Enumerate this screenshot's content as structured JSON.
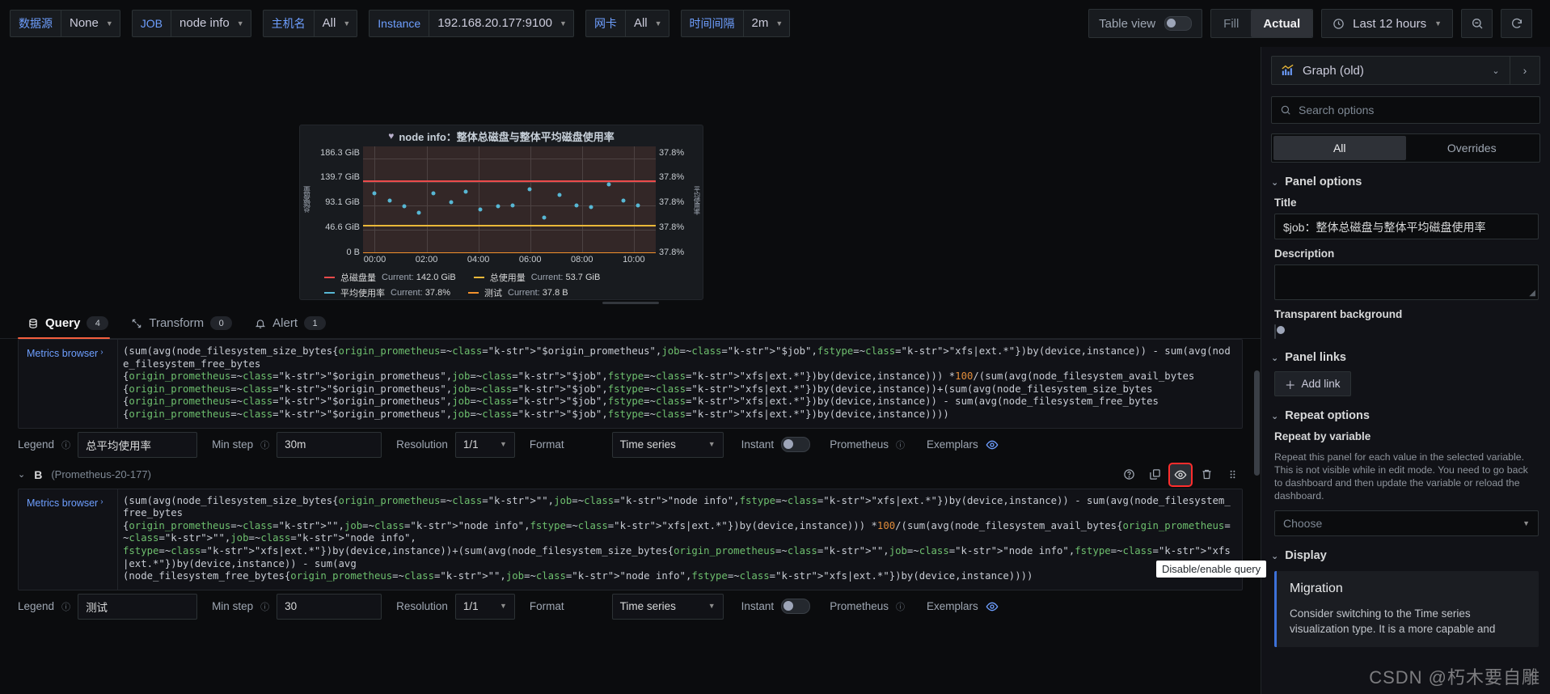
{
  "topbar": {
    "variables": [
      {
        "label": "数据源",
        "value": "None",
        "name": "datasource"
      },
      {
        "label": "JOB",
        "value": "node info",
        "name": "job"
      },
      {
        "label": "主机名",
        "value": "All",
        "name": "hostname"
      },
      {
        "label": "Instance",
        "value": "192.168.20.177:9100",
        "name": "instance"
      },
      {
        "label": "网卡",
        "value": "All",
        "name": "nic"
      },
      {
        "label": "时间间隔",
        "value": "2m",
        "name": "interval"
      }
    ],
    "table_view_label": "Table view",
    "table_view_on": false,
    "fill_label": "Fill",
    "actual_label": "Actual",
    "fill_actual_selected": "Actual",
    "time_range": "Last 12 hours",
    "zoom_out_icon": "zoom-out-icon",
    "refresh_icon": "refresh-icon",
    "clock_icon": "clock-icon"
  },
  "panel": {
    "title_prefix": "node info：",
    "title": "node info：整体总磁盘与整体平均磁盘使用率",
    "heart_icon": "heart-icon"
  },
  "chart_data": {
    "type": "scatter",
    "title": "node info：整体总磁盘与整体平均磁盘使用率",
    "xlabel": "",
    "ylabel": "总磁盘量",
    "ylabel_right": "平均使用率",
    "grid": true,
    "legend_position": "bottom",
    "y_ticks": [
      "186.3 GiB",
      "139.7 GiB",
      "93.1 GiB",
      "46.6 GiB",
      "0 B"
    ],
    "y_values": [
      186.3,
      139.7,
      93.1,
      46.6,
      0
    ],
    "y_right_ticks": [
      "37.8%",
      "37.8%",
      "37.8%",
      "37.8%",
      "37.8%"
    ],
    "x_ticks": [
      "00:00",
      "02:00",
      "04:00",
      "06:00",
      "08:00",
      "10:00"
    ],
    "ylim": [
      0,
      209.6
    ],
    "series": [
      {
        "name": "总磁盘量",
        "color": "#ec4b4b",
        "type": "line",
        "constant": 142.0,
        "current": "142.0 GiB"
      },
      {
        "name": "总使用量",
        "color": "#eab839",
        "type": "line",
        "constant": 53.7,
        "current": "53.7 GiB"
      },
      {
        "name": "平均使用率",
        "color": "#57b7d4",
        "type": "points",
        "current": "37.8%",
        "points": [
          {
            "x": 0.04,
            "y": 118
          },
          {
            "x": 0.09,
            "y": 103
          },
          {
            "x": 0.14,
            "y": 92
          },
          {
            "x": 0.19,
            "y": 79
          },
          {
            "x": 0.24,
            "y": 118
          },
          {
            "x": 0.3,
            "y": 100
          },
          {
            "x": 0.35,
            "y": 120
          },
          {
            "x": 0.4,
            "y": 86
          },
          {
            "x": 0.46,
            "y": 92
          },
          {
            "x": 0.51,
            "y": 93
          },
          {
            "x": 0.57,
            "y": 125
          },
          {
            "x": 0.62,
            "y": 70
          },
          {
            "x": 0.67,
            "y": 114
          },
          {
            "x": 0.73,
            "y": 93
          },
          {
            "x": 0.78,
            "y": 90
          },
          {
            "x": 0.84,
            "y": 135
          },
          {
            "x": 0.89,
            "y": 104
          },
          {
            "x": 0.94,
            "y": 93
          }
        ]
      },
      {
        "name": "测试",
        "color": "#f2912d",
        "type": "line",
        "constant": 3.78e-05,
        "current": "37.8 B"
      }
    ],
    "legend": [
      {
        "name": "总磁盘量",
        "color": "#ec4b4b",
        "current_label": "Current:",
        "current": "142.0 GiB"
      },
      {
        "name": "总使用量",
        "color": "#eab839",
        "current_label": "Current:",
        "current": "53.7 GiB"
      },
      {
        "name": "平均使用率",
        "color": "#57b7d4",
        "current_label": "Current:",
        "current": "37.8%"
      },
      {
        "name": "测试",
        "color": "#f2912d",
        "current_label": "Current:",
        "current": "37.8 B"
      }
    ]
  },
  "editor": {
    "tabs": [
      {
        "label": "Query",
        "count": "4",
        "icon": "database-icon",
        "active": true
      },
      {
        "label": "Transform",
        "count": "0",
        "icon": "transform-icon",
        "active": false
      },
      {
        "label": "Alert",
        "count": "1",
        "icon": "bell-icon",
        "active": false
      }
    ],
    "metrics_browser_label": "Metrics browser",
    "tooltip": "Disable/enable query",
    "queries": [
      {
        "id": "A",
        "datasource": "",
        "expr_lines": [
          "(sum(avg(node_filesystem_size_bytes{origin_prometheus=~\"$origin_prometheus\",job=~\"$job\",fstype=~\"xfs|ext.*\"})by(device,instance)) - sum(avg(node_filesystem_free_bytes",
          "{origin_prometheus=~\"$origin_prometheus\",job=~\"$job\",fstype=~\"xfs|ext.*\"})by(device,instance))) *100/(sum(avg(node_filesystem_avail_bytes",
          "{origin_prometheus=~\"$origin_prometheus\",job=~\"$job\",fstype=~\"xfs|ext.*\"})by(device,instance))+(sum(avg(node_filesystem_size_bytes",
          "{origin_prometheus=~\"$origin_prometheus\",job=~\"$job\",fstype=~\"xfs|ext.*\"})by(device,instance)) - sum(avg(node_filesystem_free_bytes",
          "{origin_prometheus=~\"$origin_prometheus\",job=~\"$job\",fstype=~\"xfs|ext.*\"})by(device,instance))))"
        ],
        "legend_label": "Legend",
        "legend_value": "总平均使用率",
        "min_step_label": "Min step",
        "min_step_value": "30m",
        "resolution_label": "Resolution",
        "resolution_value": "1/1",
        "format_label": "Format",
        "format_value": "Time series",
        "instant_label": "Instant",
        "instant_on": false,
        "prometheus_label": "Prometheus",
        "exemplars_label": "Exemplars"
      },
      {
        "id": "B",
        "datasource": "(Prometheus-20-177)",
        "expr_lines": [
          "(sum(avg(node_filesystem_size_bytes{origin_prometheus=~\"\",job=~\"node info\",fstype=~\"xfs|ext.*\"})by(device,instance)) - sum(avg(node_filesystem_free_bytes",
          "{origin_prometheus=~\"\",job=~\"node info\",fstype=~\"xfs|ext.*\"})by(device,instance))) *100/(sum(avg(node_filesystem_avail_bytes{origin_prometheus=~\"\",job=~\"node info\",",
          "fstype=~\"xfs|ext.*\"})by(device,instance))+(sum(avg(node_filesystem_size_bytes{origin_prometheus=~\"\",job=~\"node info\",fstype=~\"xfs|ext.*\"})by(device,instance)) - sum(avg",
          "(node_filesystem_free_bytes{origin_prometheus=~\"\",job=~\"node info\",fstype=~\"xfs|ext.*\"})by(device,instance))))"
        ],
        "legend_label": "Legend",
        "legend_value": "测试",
        "min_step_label": "Min step",
        "min_step_value": "30",
        "resolution_label": "Resolution",
        "resolution_value": "1/1",
        "format_label": "Format",
        "format_value": "Time series",
        "instant_label": "Instant",
        "instant_on": false,
        "prometheus_label": "Prometheus",
        "exemplars_label": "Exemplars"
      }
    ],
    "actions": {
      "help_icon": "help-circle-icon",
      "duplicate_icon": "copy-icon",
      "eye_icon": "eye-icon",
      "trash_icon": "trash-icon",
      "drag_icon": "drag-handle-icon"
    }
  },
  "options_pane": {
    "viz_name": "Graph (old)",
    "viz_icon": "graph-icon",
    "search_placeholder": "Search options",
    "tab_all": "All",
    "tab_overrides": "Overrides",
    "panel_options_header": "Panel options",
    "title_label": "Title",
    "title_value": "$job：整体总磁盘与整体平均磁盘使用率",
    "description_label": "Description",
    "description_value": "",
    "transparent_label": "Transparent background",
    "transparent_on": false,
    "panel_links_header": "Panel links",
    "add_link_label": "Add link",
    "repeat_options_header": "Repeat options",
    "repeat_by_variable_label": "Repeat by variable",
    "repeat_help": "Repeat this panel for each value in the selected variable. This is not visible while in edit mode. You need to go back to dashboard and then update the variable or reload the dashboard.",
    "repeat_choose": "Choose",
    "display_header": "Display",
    "migration_title": "Migration",
    "migration_text": "Consider switching to the Time series visualization type. It is a more capable and"
  },
  "watermark": "CSDN @朽木要自雕",
  "colors": {
    "accent_orange": "#f55f3e",
    "link_blue": "#6e9fff",
    "panel_bg": "#181b1f",
    "page_bg": "#0b0c0e",
    "plot_bg": "#332727",
    "highlight_red": "#ff2d2d"
  }
}
